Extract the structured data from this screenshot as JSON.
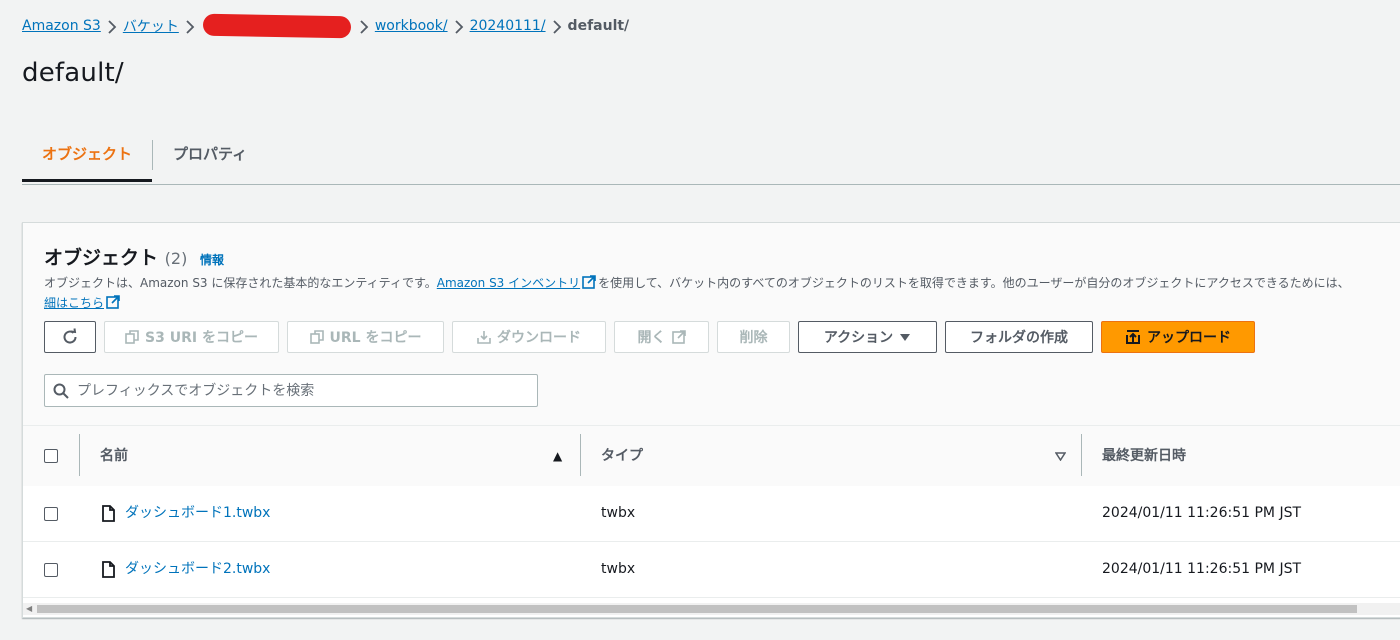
{
  "breadcrumb": {
    "items": [
      "Amazon S3",
      "バケット",
      "workbook/",
      "20240111/"
    ],
    "current": "default/"
  },
  "page": {
    "title": "default/"
  },
  "tabs": [
    {
      "label": "オブジェクト",
      "selected": true
    },
    {
      "label": "プロパティ",
      "selected": false
    }
  ],
  "panel": {
    "title": "オブジェクト",
    "count": "(2)",
    "info_label": "情報",
    "description_part1": "オブジェクトは、Amazon S3 に保存された基本的なエンティティです。",
    "inventory_link": "Amazon S3 インベントリ",
    "description_part2": "を使用して、バケット内のすべてのオブジェクトのリストを取得できます。他のユーザーが自分のオブジェクトにアクセスできるためには、",
    "details_link": "細はこちら"
  },
  "toolbar": {
    "refresh_icon": "refresh-icon",
    "copy_s3_uri": "S3 URI をコピー",
    "copy_url": "URL をコピー",
    "download": "ダウンロード",
    "open": "開く",
    "delete": "削除",
    "actions": "アクション",
    "create_folder": "フォルダの作成",
    "upload": "アップロード"
  },
  "search": {
    "placeholder": "プレフィックスでオブジェクトを検索",
    "value": ""
  },
  "table": {
    "columns": [
      "名前",
      "タイプ",
      "最終更新日時"
    ],
    "rows": [
      {
        "name": "ダッシュボード1.twbx",
        "type": "twbx",
        "modified": "2024/01/11 11:26:51 PM JST"
      },
      {
        "name": "ダッシュボード2.twbx",
        "type": "twbx",
        "modified": "2024/01/11 11:26:51 PM JST"
      }
    ]
  },
  "colors": {
    "link": "#0073bb",
    "accent": "#ec7211",
    "primary_button": "#ff9900",
    "redaction": "#e5201f"
  }
}
